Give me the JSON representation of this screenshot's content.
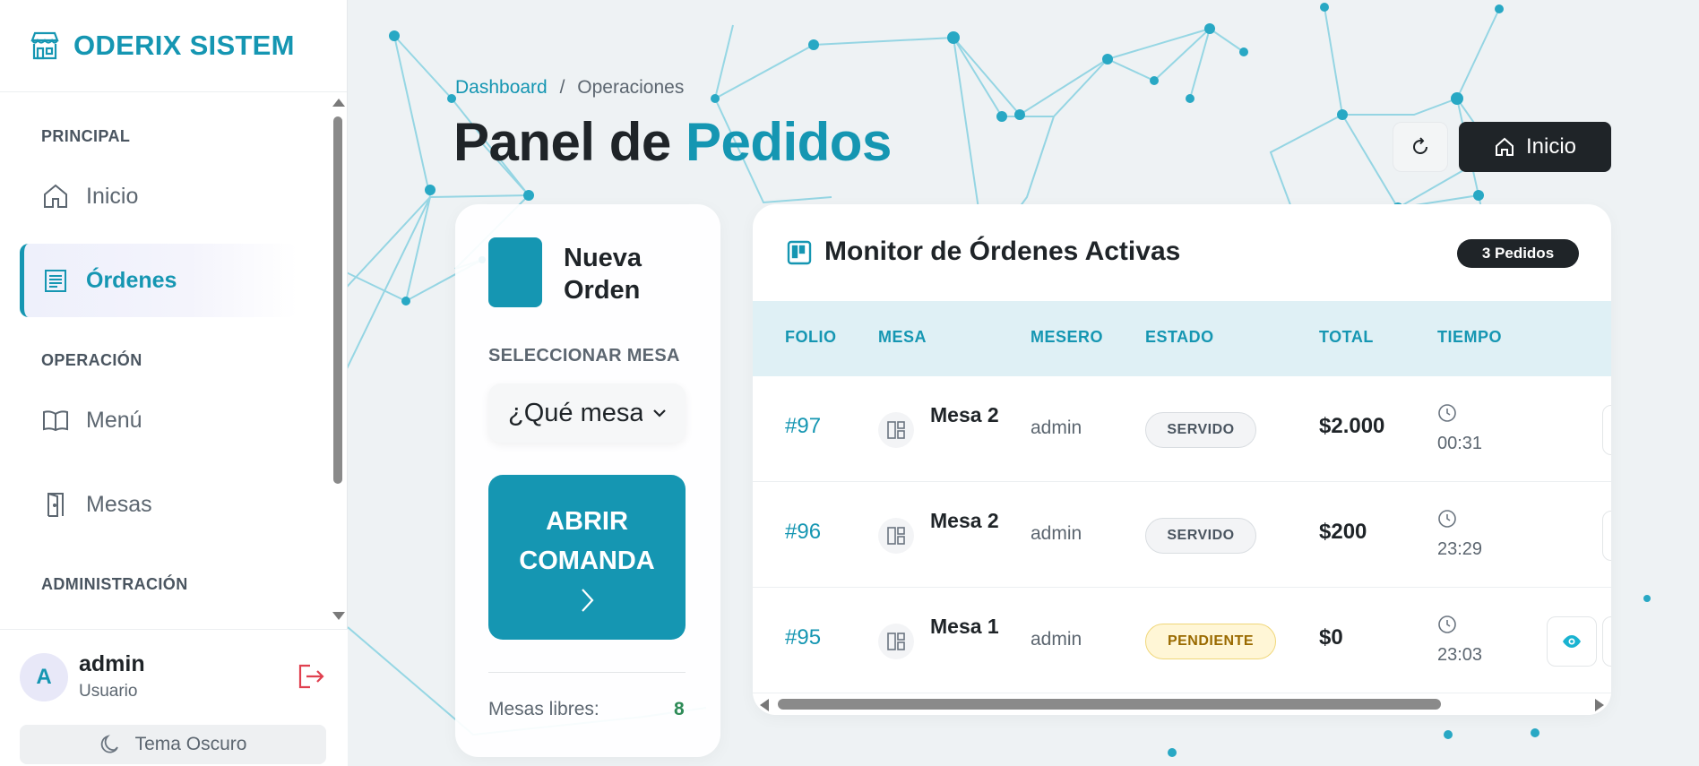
{
  "app": {
    "brand": "ODERIX SISTEM"
  },
  "sidebar": {
    "sections": [
      "PRINCIPAL",
      "OPERACIÓN",
      "ADMINISTRACIÓN"
    ],
    "items": [
      {
        "label": "Inicio",
        "icon": "home-icon"
      },
      {
        "label": "Órdenes",
        "icon": "receipt-icon",
        "active": true
      },
      {
        "label": "Menú",
        "icon": "book-icon"
      },
      {
        "label": "Mesas",
        "icon": "door-icon"
      }
    ]
  },
  "user": {
    "initial": "A",
    "name": "admin",
    "role": "Usuario",
    "theme_label": "Tema Oscuro"
  },
  "breadcrumb": {
    "link": "Dashboard",
    "separator": "/",
    "current": "Operaciones"
  },
  "page": {
    "title_main": "Panel de ",
    "title_accent": "Pedidos"
  },
  "header_actions": {
    "home_label": "Inicio"
  },
  "new_order": {
    "title": "Nueva Orden",
    "select_label": "SELECCIONAR MESA",
    "select_value": "¿Qué mesa?",
    "open_button": "ABRIR COMANDA",
    "free_label": "Mesas libres:",
    "free_count": "8"
  },
  "monitor": {
    "title": "Monitor de Órdenes Activas",
    "count_badge": "3 Pedidos",
    "columns": [
      "FOLIO",
      "MESA",
      "MESERO",
      "ESTADO",
      "TOTAL",
      "TIEMPO"
    ],
    "rows": [
      {
        "folio": "#97",
        "mesa": "Mesa 2",
        "mesero": "admin",
        "estado": "SERVIDO",
        "total": "$2.000",
        "tiempo": "00:31"
      },
      {
        "folio": "#96",
        "mesa": "Mesa 2",
        "mesero": "admin",
        "estado": "SERVIDO",
        "total": "$200",
        "tiempo": "23:29"
      },
      {
        "folio": "#95",
        "mesa": "Mesa 1",
        "mesero": "admin",
        "estado": "PENDIENTE",
        "total": "$0",
        "tiempo": "23:03"
      }
    ]
  },
  "colors": {
    "accent": "#1596b2",
    "dark": "#1f2428",
    "pending": "#fff6d6",
    "free_count": "#2e8b57"
  }
}
